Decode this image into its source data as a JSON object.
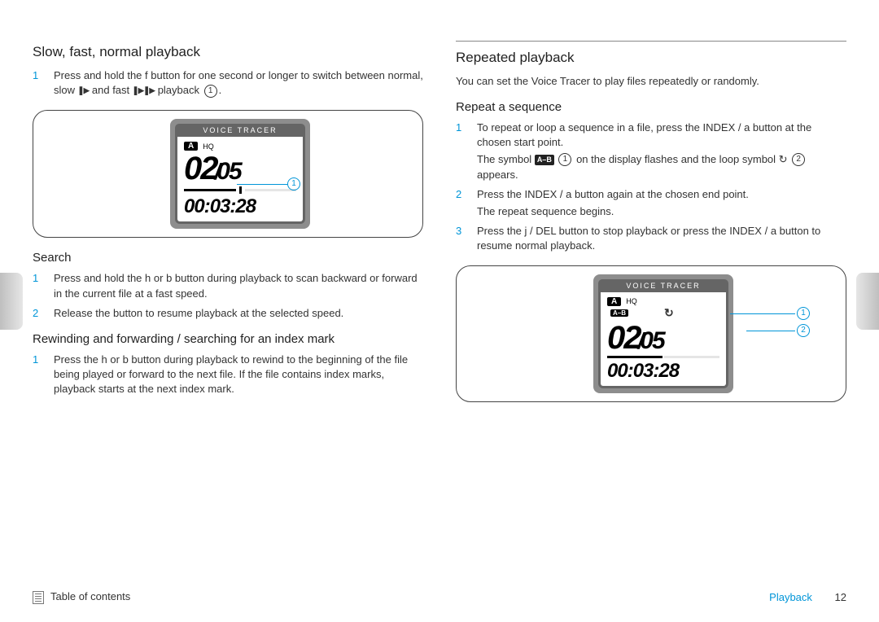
{
  "left": {
    "h_playback": "Slow, fast, normal playback",
    "step1_a": "Press and hold the ",
    "step1_btn": "f",
    "step1_b": " button for one second or longer to switch between normal, slow ",
    "step1_c": " and fast ",
    "step1_d": " playback ",
    "step1_ref": "1",
    "step1_e": ".",
    "h_search": "Search",
    "s1_a": "Press and hold the ",
    "s1_h": "h",
    "s1_or": " or ",
    "s1_b": "b",
    "s1_c": " button during playback to scan backward or forward in the current file at a fast speed.",
    "s2": "Release the button to resume playback at the selected speed.",
    "h_rewind": "Rewinding and forwarding / searching for an index mark",
    "r1_a": "Press the ",
    "r1_h": "h",
    "r1_or": " or ",
    "r1_b": "b",
    "r1_c": " button during playback to rewind to the beginning of the file being played or forward to the next file. If the file contains index marks, playback starts at the next index mark."
  },
  "right": {
    "h_repeat": "Repeated playback",
    "intro": "You can set the Voice Tracer to play files repeatedly or randomly.",
    "h_seq": "Repeat a sequence",
    "q1_a": "To repeat or loop a sequence in a file, press the ",
    "q1_btn": "INDEX / a",
    "q1_b": " button at the chosen start point.",
    "q1_sub_a": "The symbol ",
    "q1_chip": "A–B",
    "q1_ref1": "1",
    "q1_sub_b": " on the display flashes and the loop symbol ",
    "q1_ref2": "2",
    "q1_sub_c": " appears.",
    "q2_a": "Press the ",
    "q2_btn": "INDEX / a",
    "q2_b": " button again at the chosen end point.",
    "q2_sub": "The repeat sequence begins.",
    "q3_a": "Press the ",
    "q3_btn1": "j / DEL",
    "q3_b": " button to stop playback or press the ",
    "q3_btn2": "INDEX / a",
    "q3_c": " button to resume normal playback."
  },
  "device": {
    "brand": "VOICE TRACER",
    "folder": "A",
    "hq": "HQ",
    "ab": "A–B",
    "track": "02",
    "total": "05",
    "time": "00:03:28"
  },
  "footer": {
    "toc": "Table of contents",
    "section": "Playback",
    "page": "12"
  }
}
